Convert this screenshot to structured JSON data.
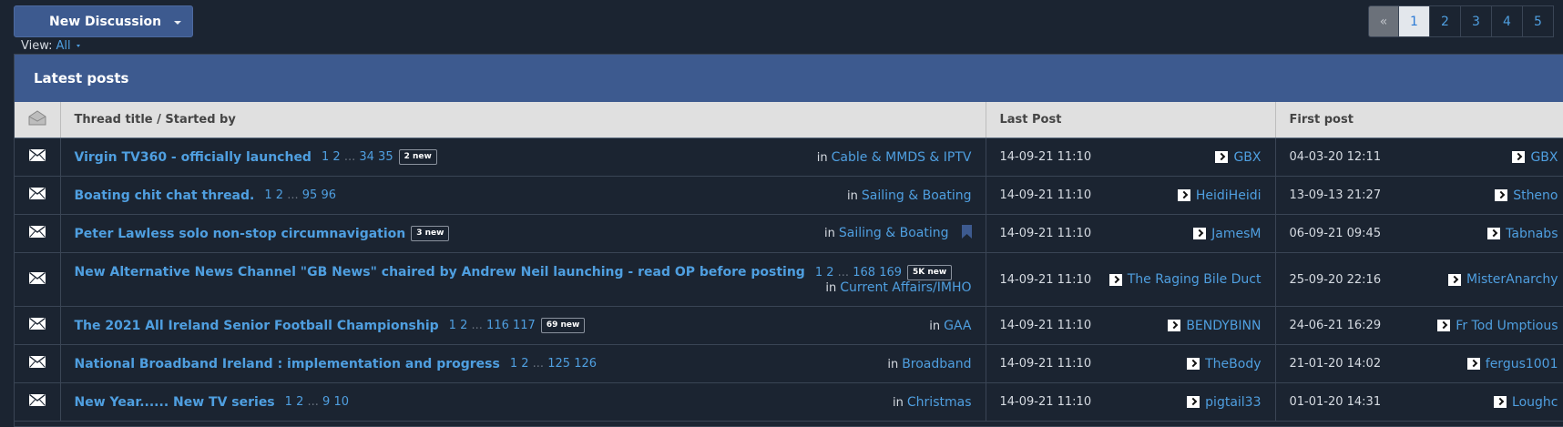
{
  "toolbar": {
    "new_discussion": "New Discussion",
    "view_label": "View:",
    "view_value": "All"
  },
  "pagination": {
    "prev": "«",
    "pages": [
      "1",
      "2",
      "3",
      "4",
      "5"
    ],
    "current": "1"
  },
  "panel": {
    "title": "Latest posts"
  },
  "columns": {
    "title": "Thread title / Started by",
    "last": "Last Post",
    "first": "First post"
  },
  "threads": [
    {
      "title": "Virgin TV360 - officially launched",
      "pages": [
        "1",
        "2",
        "...",
        "34",
        "35"
      ],
      "badge": "2 new",
      "in": "in",
      "forum": "Cable & MMDS & IPTV",
      "last_date": "14-09-21 11:10",
      "last_user": "GBX",
      "first_date": "04-03-20 12:11",
      "first_user": "GBX"
    },
    {
      "title": "Boating chit chat thread.",
      "pages": [
        "1",
        "2",
        "...",
        "95",
        "96"
      ],
      "badge": "",
      "in": "in",
      "forum": "Sailing & Boating",
      "last_date": "14-09-21 11:10",
      "last_user": "HeidiHeidi",
      "first_date": "13-09-13 21:27",
      "first_user": "Stheno"
    },
    {
      "title": "Peter Lawless solo non-stop circumnavigation",
      "pages": [],
      "badge": "3 new",
      "in": "in",
      "forum": "Sailing & Boating",
      "last_date": "14-09-21 11:10",
      "last_user": "JamesM",
      "first_date": "06-09-21 09:45",
      "first_user": "Tabnabs"
    },
    {
      "title": "New Alternative News Channel \"GB News\" chaired by Andrew Neil launching - read OP before posting",
      "pages": [
        "1",
        "2",
        "...",
        "168",
        "169"
      ],
      "badge": "5K new",
      "in": "in",
      "forum": "Current Affairs/IMHO",
      "last_date": "14-09-21 11:10",
      "last_user": "The Raging Bile Duct",
      "first_date": "25-09-20 22:16",
      "first_user": "MisterAnarchy"
    },
    {
      "title": "The 2021 All Ireland Senior Football Championship",
      "pages": [
        "1",
        "2",
        "...",
        "116",
        "117"
      ],
      "badge": "69 new",
      "in": "in",
      "forum": "GAA",
      "last_date": "14-09-21 11:10",
      "last_user": "BENDYBINN",
      "first_date": "24-06-21 16:29",
      "first_user": "Fr Tod Umptious"
    },
    {
      "title": "National Broadband Ireland : implementation and progress",
      "pages": [
        "1",
        "2",
        "...",
        "125",
        "126"
      ],
      "badge": "",
      "in": "in",
      "forum": "Broadband",
      "last_date": "14-09-21 11:10",
      "last_user": "TheBody",
      "first_date": "21-01-20 14:02",
      "first_user": "fergus1001"
    },
    {
      "title": "New Year...... New TV series",
      "pages": [
        "1",
        "2",
        "...",
        "9",
        "10"
      ],
      "badge": "",
      "in": "in",
      "forum": "Christmas",
      "last_date": "14-09-21 11:10",
      "last_user": "pigtail33",
      "first_date": "01-01-20 14:31",
      "first_user": "Loughc"
    }
  ],
  "colors": {
    "accent": "#3d5a8f",
    "link": "#4f9fe0",
    "background": "#1b2431"
  }
}
